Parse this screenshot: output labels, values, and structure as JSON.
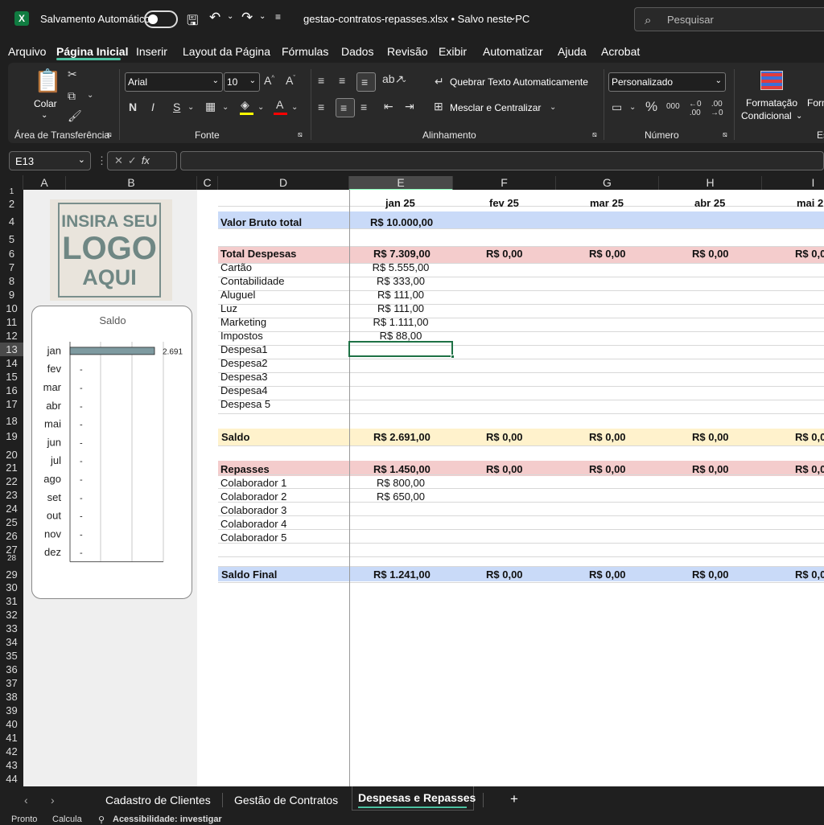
{
  "titlebar": {
    "app_icon": "X",
    "autosave_label": "Salvamento Automático",
    "file_title": "gestao-contratos-repasses.xlsx • Salvo neste PC",
    "search_placeholder": "Pesquisar"
  },
  "menu": [
    "Arquivo",
    "Página Inicial",
    "Inserir",
    "Layout da Página",
    "Fórmulas",
    "Dados",
    "Revisão",
    "Exibir",
    "Automatizar",
    "Ajuda",
    "Acrobat"
  ],
  "ribbon": {
    "paste_label": "Colar",
    "clipboard_group": "Área de Transferência",
    "font_name": "Arial",
    "font_size": "10",
    "bold": "N",
    "italic": "I",
    "underline": "S",
    "font_group": "Fonte",
    "wrap_text": "Quebrar Texto Automaticamente",
    "merge_center": "Mesclar e Centralizar",
    "alignment_group": "Alinhamento",
    "number_format": "Personalizado",
    "number_group": "Número",
    "cond_format_1": "Formatação",
    "cond_format_2": "Condicional",
    "format_table_partial": "Form",
    "styles_partial": "Es"
  },
  "formula_bar": {
    "name_box": "E13",
    "fx": "fx",
    "value": ""
  },
  "columns": [
    "A",
    "B",
    "C",
    "D",
    "E",
    "F",
    "G",
    "H",
    "I"
  ],
  "rows": [
    "1",
    "2",
    "4",
    "5",
    "6",
    "7",
    "8",
    "9",
    "10",
    "11",
    "12",
    "13",
    "14",
    "15",
    "16",
    "17",
    "18",
    "19",
    "20",
    "21",
    "22",
    "23",
    "24",
    "25",
    "26",
    "27",
    "28",
    "29",
    "30",
    "31",
    "32",
    "33",
    "34",
    "35",
    "36",
    "37",
    "38",
    "39",
    "40",
    "41",
    "42",
    "43",
    "44"
  ],
  "logo": {
    "line1": "INSIRA SEU",
    "line2": "LOGO",
    "line3": "AQUI"
  },
  "chart_data": {
    "type": "bar",
    "title": "Saldo",
    "categories": [
      "jan",
      "fev",
      "mar",
      "abr",
      "mai",
      "jun",
      "jul",
      "ago",
      "set",
      "out",
      "nov",
      "dez"
    ],
    "values": [
      2691,
      0,
      0,
      0,
      0,
      0,
      0,
      0,
      0,
      0,
      0,
      0
    ],
    "data_labels": [
      "2.691",
      "-",
      "-",
      "-",
      "-",
      "-",
      "-",
      "-",
      "-",
      "-",
      "-",
      "-"
    ],
    "orientation": "horizontal",
    "grid": true
  },
  "months": [
    "jan 25",
    "fev 25",
    "mar 25",
    "abr 25",
    "mai 2"
  ],
  "table": {
    "valor_bruto_label": "Valor Bruto total",
    "valor_bruto": "R$ 10.000,00",
    "total_despesas_label": "Total Despesas",
    "total_despesas": [
      "R$ 7.309,00",
      "R$ 0,00",
      "R$ 0,00",
      "R$ 0,00",
      "R$ 0,0"
    ],
    "despesas": [
      {
        "label": "Cartão",
        "value": "R$ 5.555,00"
      },
      {
        "label": "Contabilidade",
        "value": "R$ 333,00"
      },
      {
        "label": "Aluguel",
        "value": "R$ 111,00"
      },
      {
        "label": "Luz",
        "value": "R$ 111,00"
      },
      {
        "label": "Marketing",
        "value": "R$ 1.111,00"
      },
      {
        "label": "Impostos",
        "value": "R$ 88,00"
      },
      {
        "label": "Despesa1",
        "value": ""
      },
      {
        "label": "Despesa2",
        "value": ""
      },
      {
        "label": "Despesa3",
        "value": ""
      },
      {
        "label": "Despesa4",
        "value": ""
      },
      {
        "label": "Despesa 5",
        "value": ""
      }
    ],
    "saldo_label": "Saldo",
    "saldo": [
      "R$ 2.691,00",
      "R$ 0,00",
      "R$ 0,00",
      "R$ 0,00",
      "R$ 0,0"
    ],
    "repasses_label": "Repasses",
    "repasses": [
      "R$ 1.450,00",
      "R$ 0,00",
      "R$ 0,00",
      "R$ 0,00",
      "R$ 0,0"
    ],
    "colaboradores": [
      {
        "label": "Colaborador 1",
        "value": "R$ 800,00"
      },
      {
        "label": "Colaborador 2",
        "value": "R$ 650,00"
      },
      {
        "label": "Colaborador 3",
        "value": ""
      },
      {
        "label": "Colaborador 4",
        "value": ""
      },
      {
        "label": "Colaborador 5",
        "value": ""
      }
    ],
    "saldo_final_label": "Saldo Final",
    "saldo_final": [
      "R$ 1.241,00",
      "R$ 0,00",
      "R$ 0,00",
      "R$ 0,00",
      "R$ 0,0"
    ]
  },
  "tabs": {
    "items": [
      "Cadastro de Clientes",
      "Gestão de Contratos",
      "Despesas e Repasses"
    ],
    "active": "Despesas e Repasses",
    "add": "+"
  },
  "status": {
    "ready": "Pronto",
    "calc": "Calcula",
    "accessibility": "Acessibilidade: investigar"
  },
  "colors": {
    "blue_band": "#c9daf8",
    "red_band": "#f4cccc",
    "yellow_band": "#fff2cc",
    "bar": "#7e9aa0",
    "excel_green": "#107c41"
  }
}
